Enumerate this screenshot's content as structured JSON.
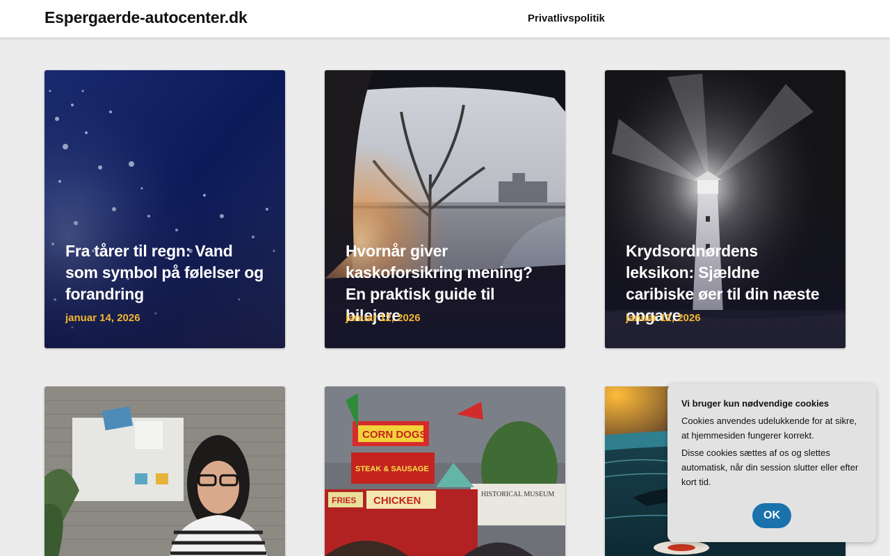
{
  "header": {
    "site_title": "Espergaerde-autocenter.dk",
    "nav": [
      {
        "label": "Privatlivspolitik"
      }
    ]
  },
  "posts": [
    {
      "title": "Fra tårer til regn: Vand som symbol på følelser og forandring",
      "date": "januar 14, 2026"
    },
    {
      "title": "Hvornår giver kaskoforsikring mening? En praktisk guide til bilejere",
      "date": "januar 12, 2026"
    },
    {
      "title": "Krydsordnørdens leksikon: Sjældne caribiske øer til din næste opgave",
      "date": "januar 12, 2026"
    }
  ],
  "image_text": {
    "stand_1": "CORN DOGS",
    "stand_2": "STEAK & SAUSAGE",
    "stand_3": "FRIES",
    "stand_4": "CHICKEN",
    "stand_5": "HISTORICAL MUSEUM"
  },
  "cookie_banner": {
    "title": "Vi bruger kun nødvendige cookies",
    "text_1": "Cookies anvendes udelukkende for at sikre, at hjemmesiden fungerer korrekt.",
    "text_2": "Disse cookies sættes af os og slettes automatisk, når din session slutter eller efter kort tid.",
    "ok_label": "OK"
  },
  "colors": {
    "accent_date": "#f2b632",
    "ok_button": "#1a72ad",
    "page_bg": "#ececec"
  }
}
